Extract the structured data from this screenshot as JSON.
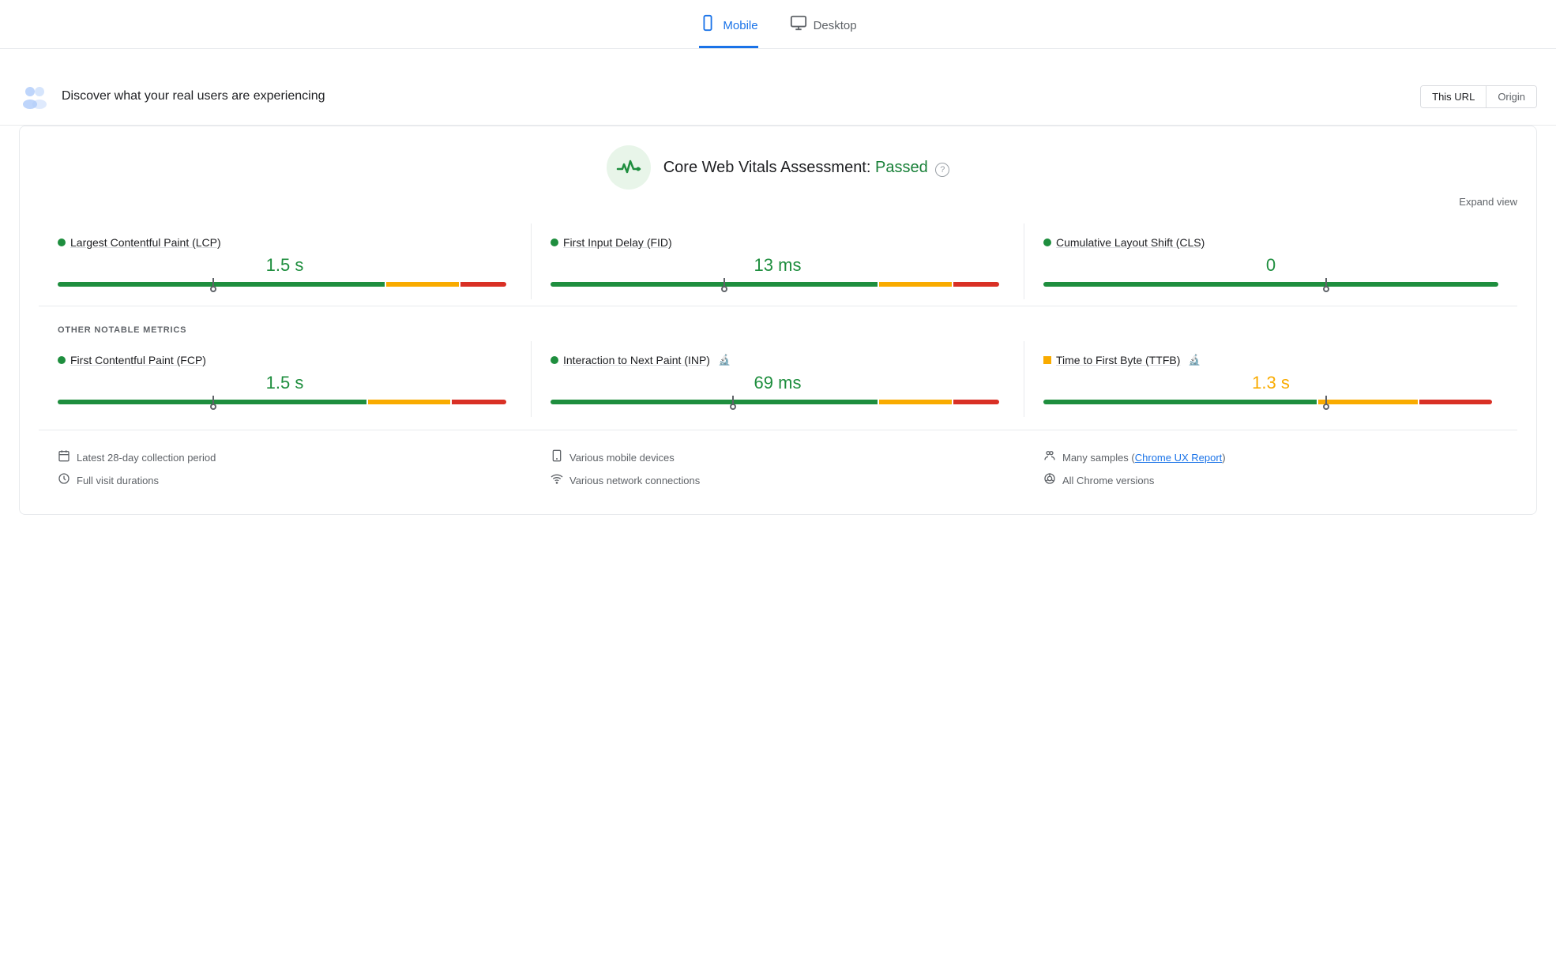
{
  "tabs": [
    {
      "id": "mobile",
      "label": "Mobile",
      "active": true,
      "icon": "📱"
    },
    {
      "id": "desktop",
      "label": "Desktop",
      "active": false,
      "icon": "🖥"
    }
  ],
  "header": {
    "title": "Discover what your real users are experiencing",
    "this_url_label": "This URL",
    "origin_label": "Origin"
  },
  "cwv": {
    "assessment_label": "Core Web Vitals Assessment:",
    "passed_label": "Passed",
    "expand_label": "Expand view"
  },
  "metrics": [
    {
      "id": "lcp",
      "name": "Largest Contentful Paint (LCP)",
      "value": "1.5 s",
      "status": "good",
      "bar": {
        "green": 72,
        "orange": 16,
        "red": 12,
        "marker": 34
      }
    },
    {
      "id": "fid",
      "name": "First Input Delay (FID)",
      "value": "13 ms",
      "status": "good",
      "bar": {
        "green": 72,
        "orange": 16,
        "red": 12,
        "marker": 38
      }
    },
    {
      "id": "cls",
      "name": "Cumulative Layout Shift (CLS)",
      "value": "0",
      "status": "good",
      "bar": {
        "green": 100,
        "orange": 0,
        "red": 0,
        "marker": 62
      }
    }
  ],
  "other_metrics_label": "OTHER NOTABLE METRICS",
  "other_metrics": [
    {
      "id": "fcp",
      "name": "First Contentful Paint (FCP)",
      "value": "1.5 s",
      "status": "good",
      "has_lab": false,
      "bar": {
        "green": 68,
        "orange": 18,
        "red": 14,
        "marker": 34
      }
    },
    {
      "id": "inp",
      "name": "Interaction to Next Paint (INP)",
      "value": "69 ms",
      "status": "good",
      "has_lab": true,
      "bar": {
        "green": 72,
        "orange": 16,
        "red": 12,
        "marker": 40
      }
    },
    {
      "id": "ttfb",
      "name": "Time to First Byte (TTFB)",
      "value": "1.3 s",
      "status": "needs-improvement",
      "has_lab": true,
      "bar": {
        "green": 60,
        "orange": 22,
        "red": 18,
        "marker": 62
      }
    }
  ],
  "footer": {
    "col1": [
      {
        "icon": "📅",
        "text": "Latest 28-day collection period"
      },
      {
        "icon": "⏱",
        "text": "Full visit durations"
      }
    ],
    "col2": [
      {
        "icon": "📱",
        "text": "Various mobile devices"
      },
      {
        "icon": "📶",
        "text": "Various network connections"
      }
    ],
    "col3": [
      {
        "icon": "👥",
        "text": "Many samples",
        "link": "Chrome UX Report"
      },
      {
        "icon": "◎",
        "text": "All Chrome versions"
      }
    ]
  }
}
